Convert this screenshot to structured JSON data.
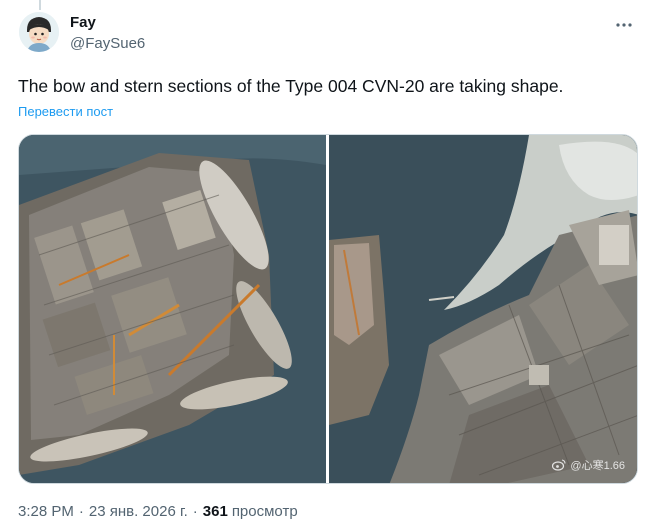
{
  "author": {
    "name": "Fay",
    "handle": "@FaySue6"
  },
  "tweet": {
    "text": "The bow and stern sections of the Type 004 CVN-20 are taking shape.",
    "translate_label": "Перевести пост"
  },
  "media": {
    "watermark": "@心寒1.66"
  },
  "meta": {
    "time": "3:28 PM",
    "separator": "·",
    "date": "23 янв. 2026 г.",
    "views_count": "361",
    "views_label": "просмотр"
  },
  "icons": {
    "more": "more-horizontal-icon",
    "avatar": "avatar-image",
    "watermark": "weibo-icon"
  }
}
